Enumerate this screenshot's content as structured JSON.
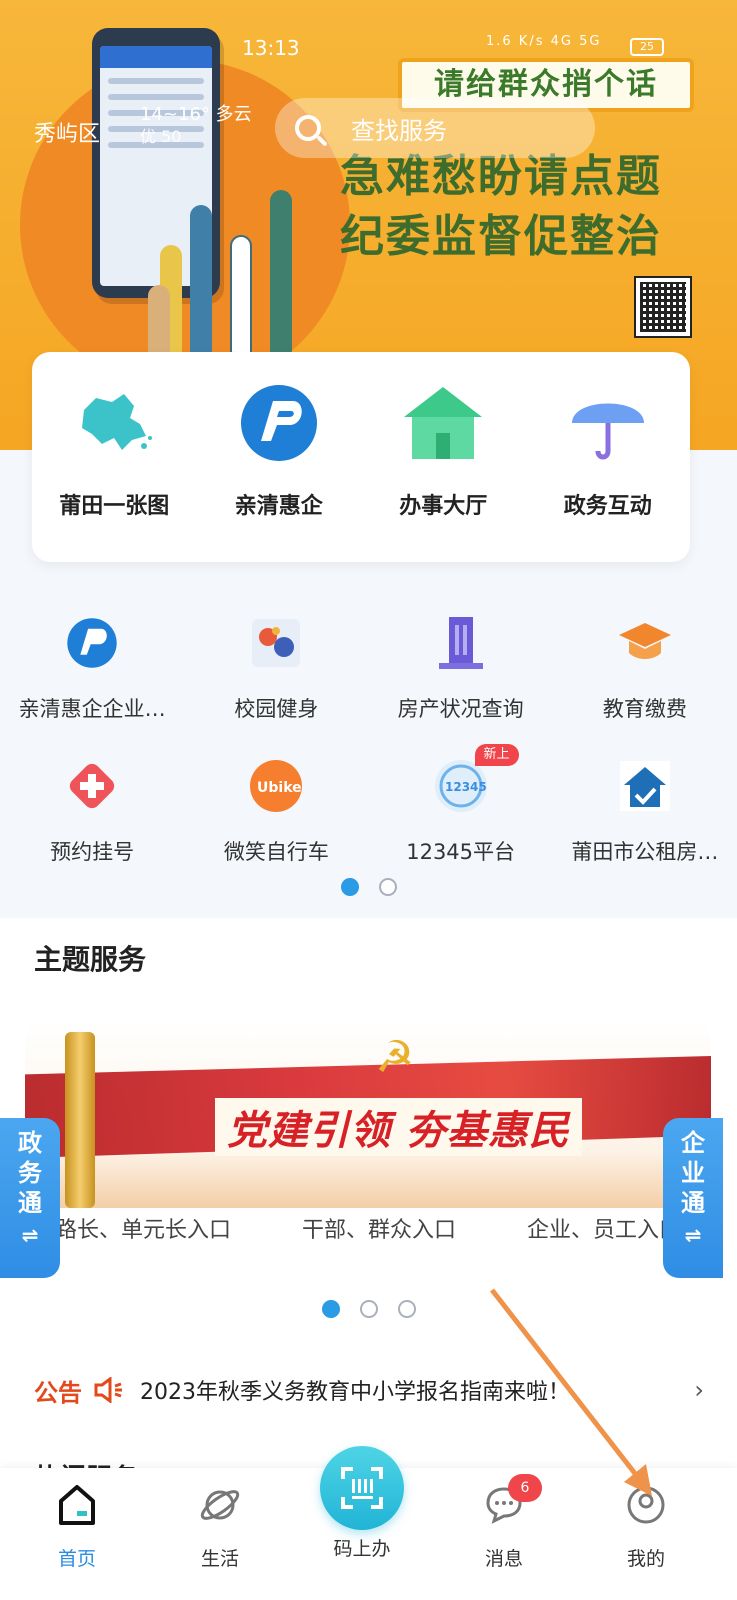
{
  "status_bar": {
    "time": "13:13",
    "signal": "1.6 K/s 4G 5G",
    "battery": "25"
  },
  "header": {
    "location": "秀屿区",
    "weather": "14~16° 多云",
    "aqi": "优 50",
    "search_placeholder": "查找服务"
  },
  "banner": {
    "box_text": "请给群众捎个话",
    "line1": "急难愁盼请点题",
    "line2": "纪委监督促整治"
  },
  "quick_services": [
    {
      "label": "莆田一张图",
      "icon": "map-icon"
    },
    {
      "label": "亲清惠企",
      "icon": "qinqing-logo-icon"
    },
    {
      "label": "办事大厅",
      "icon": "hall-icon"
    },
    {
      "label": "政务互动",
      "icon": "umbrella-icon"
    }
  ],
  "service_grid": [
    {
      "label": "亲清惠企企业…",
      "icon": "qinqing-logo-icon"
    },
    {
      "label": "校园健身",
      "icon": "campus-fitness-icon"
    },
    {
      "label": "房产状况查询",
      "icon": "building-icon"
    },
    {
      "label": "教育缴费",
      "icon": "graduation-cap-icon"
    },
    {
      "label": "预约挂号",
      "icon": "medical-cross-icon"
    },
    {
      "label": "微笑自行车",
      "icon": "ubike-icon"
    },
    {
      "label": "12345平台",
      "icon": "hotline-12345-icon",
      "badge": "新上"
    },
    {
      "label": "莆田市公租房…",
      "icon": "house-check-icon"
    }
  ],
  "pager1": {
    "active_index": 0,
    "count": 2
  },
  "theme": {
    "title": "主题服务",
    "banner_text": "党建引领  夯基惠民",
    "entrances": [
      "路长、单元长入口",
      "干部、群众入口",
      "企业、员工入口"
    ]
  },
  "pager2": {
    "active_index": 0,
    "count": 3
  },
  "side_tabs": {
    "left": [
      "政",
      "务",
      "通"
    ],
    "right": [
      "企",
      "业",
      "通"
    ]
  },
  "notice": {
    "tag": "公告",
    "text": "2023年秋季义务教育中小学报名指南来啦！"
  },
  "peek_title": "热门服务",
  "tabbar": {
    "home": "首页",
    "life": "生活",
    "scan": "码上办",
    "messages": "消息",
    "message_count": "6",
    "mine": "我的"
  },
  "colors": {
    "accent": "#2a8de0",
    "banner_orange": "#f5a623",
    "notice_red": "#e24a1b"
  }
}
